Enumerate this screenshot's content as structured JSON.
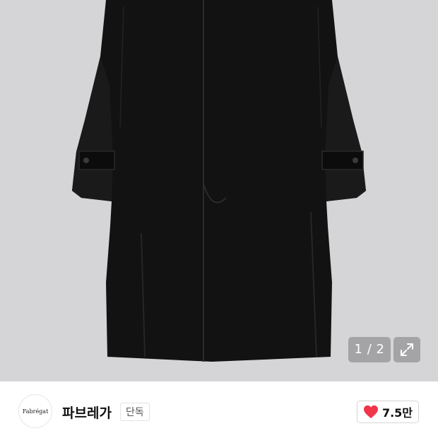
{
  "product_image": {
    "alt_subject": "black long coat",
    "counter": "1 / 2"
  },
  "brand": {
    "logo_text": "Fabrégat",
    "name": "파브레가",
    "badge": "단독"
  },
  "like": {
    "icon": "heart-icon",
    "count": "7.5만",
    "color": "#f0364a"
  }
}
